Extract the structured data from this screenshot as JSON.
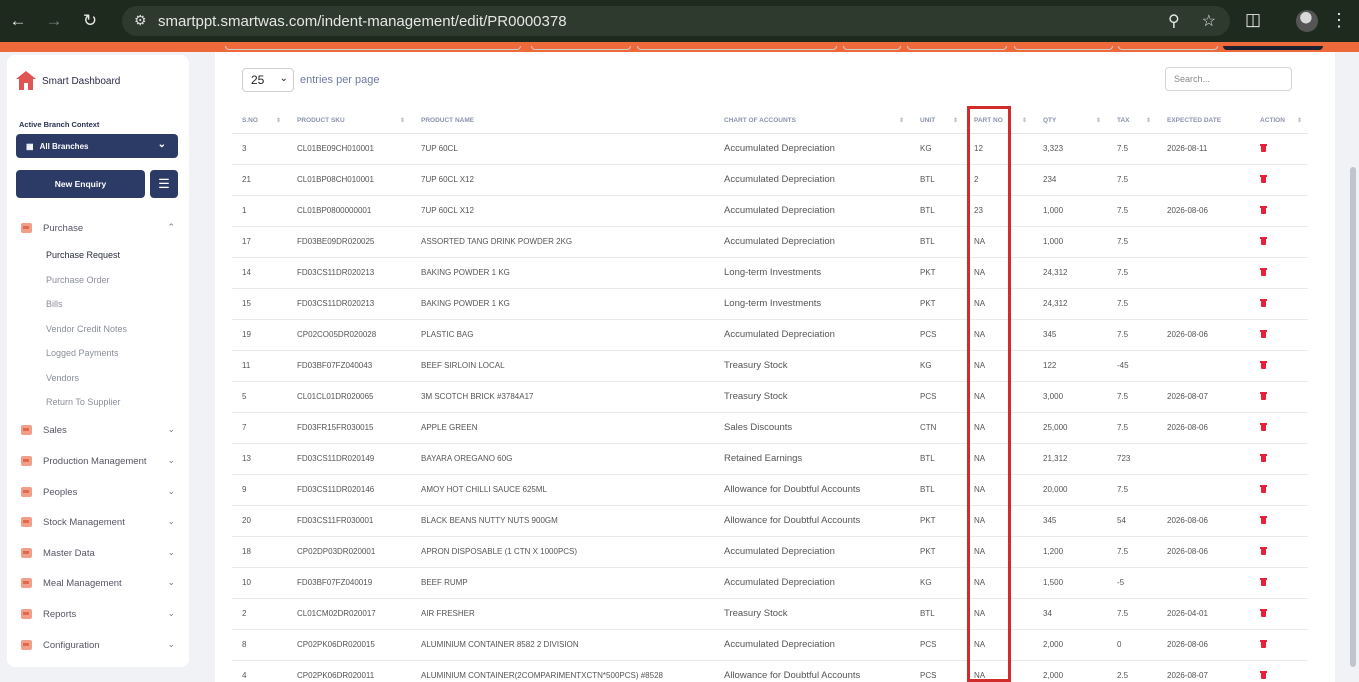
{
  "browser": {
    "url": "smartppt.smartwas.com/indent-management/edit/PR0000378"
  },
  "sidebar": {
    "brand": "Smart Dashboard",
    "branch_label": "Active Branch Context",
    "branch_value": "All Branches",
    "new_enquiry": "New Enquiry",
    "menu": [
      {
        "label": "Purchase"
      },
      {
        "label": "Sales"
      },
      {
        "label": "Production Management"
      },
      {
        "label": "Peoples"
      },
      {
        "label": "Stock Management"
      },
      {
        "label": "Master Data"
      },
      {
        "label": "Meal Management"
      },
      {
        "label": "Reports"
      },
      {
        "label": "Configuration"
      }
    ],
    "purchase_sub": [
      {
        "label": "Purchase Request"
      },
      {
        "label": "Purchase Order"
      },
      {
        "label": "Bills"
      },
      {
        "label": "Vendor Credit Notes"
      },
      {
        "label": "Logged Payments"
      },
      {
        "label": "Vendors"
      },
      {
        "label": "Return To Supplier"
      }
    ]
  },
  "table_controls": {
    "entries_value": "25",
    "entries_text": "entries per page",
    "search_placeholder": "Search..."
  },
  "table": {
    "headers": [
      "S.NO",
      "PRODUCT SKU",
      "PRODUCT NAME",
      "CHART OF ACCOUNTS",
      "UNIT",
      "PART NO",
      "QTY",
      "TAX",
      "EXPECTED DATE",
      "ACTION"
    ],
    "rows": [
      [
        "3",
        "CL01BE09CH010001",
        "7UP 60CL",
        "Accumulated Depreciation",
        "KG",
        "12",
        "3,323",
        "7.5",
        "2026-08-11"
      ],
      [
        "21",
        "CL01BP08CH010001",
        "7UP 60CL X12",
        "Accumulated Depreciation",
        "BTL",
        "2",
        "234",
        "7.5",
        ""
      ],
      [
        "1",
        "CL01BP0800000001",
        "7UP 60CL X12",
        "Accumulated Depreciation",
        "BTL",
        "23",
        "1,000",
        "7.5",
        "2026-08-06"
      ],
      [
        "17",
        "FD03BE09DR020025",
        "ASSORTED TANG DRINK POWDER 2KG",
        "Accumulated Depreciation",
        "BTL",
        "NA",
        "1,000",
        "7.5",
        ""
      ],
      [
        "14",
        "FD03CS11DR020213",
        "BAKING POWDER 1 KG",
        "Long-term Investments",
        "PKT",
        "NA",
        "24,312",
        "7.5",
        ""
      ],
      [
        "15",
        "FD03CS11DR020213",
        "BAKING POWDER 1 KG",
        "Long-term Investments",
        "PKT",
        "NA",
        "24,312",
        "7.5",
        ""
      ],
      [
        "19",
        "CP02CO05DR020028",
        "PLASTIC BAG",
        "Accumulated Depreciation",
        "PCS",
        "NA",
        "345",
        "7.5",
        "2026-08-06"
      ],
      [
        "11",
        "FD03BF07FZ040043",
        "BEEF SIRLOIN LOCAL",
        "Treasury Stock",
        "KG",
        "NA",
        "122",
        "-45",
        ""
      ],
      [
        "5",
        "CL01CL01DR020065",
        "3M SCOTCH BRICK #3784A17",
        "Treasury Stock",
        "PCS",
        "NA",
        "3,000",
        "7.5",
        "2026-08-07"
      ],
      [
        "7",
        "FD03FR15FR030015",
        "APPLE GREEN",
        "Sales Discounts",
        "CTN",
        "NA",
        "25,000",
        "7.5",
        "2026-08-06"
      ],
      [
        "13",
        "FD03CS11DR020149",
        "BAYARA OREGANO 60G",
        "Retained Earnings",
        "BTL",
        "NA",
        "21,312",
        "723",
        ""
      ],
      [
        "9",
        "FD03CS11DR020146",
        "AMOY HOT CHILLI SAUCE 625ML",
        "Allowance for Doubtful Accounts",
        "BTL",
        "NA",
        "20,000",
        "7.5",
        ""
      ],
      [
        "20",
        "FD03CS11FR030001",
        "BLACK BEANS NUTTY NUTS 900GM",
        "Allowance for Doubtful Accounts",
        "PKT",
        "NA",
        "345",
        "54",
        "2026-08-06"
      ],
      [
        "18",
        "CP02DP03DR020001",
        "APRON DISPOSABLE (1 CTN X 1000PCS)",
        "Accumulated Depreciation",
        "PKT",
        "NA",
        "1,200",
        "7.5",
        "2026-08-06"
      ],
      [
        "10",
        "FD03BF07FZ040019",
        "BEEF RUMP",
        "Accumulated Depreciation",
        "KG",
        "NA",
        "1,500",
        "-5",
        ""
      ],
      [
        "2",
        "CL01CM02DR020017",
        "AIR FRESHER",
        "Treasury Stock",
        "BTL",
        "NA",
        "34",
        "7.5",
        "2026-04-01"
      ],
      [
        "8",
        "CP02PK06DR020015",
        "ALUMINIUM CONTAINER 8582 2 DIVISION",
        "Accumulated Depreciation",
        "PCS",
        "NA",
        "2,000",
        "0",
        "2026-08-06"
      ],
      [
        "4",
        "CP02PK06DR020011",
        "ALUMINIUM CONTAINER(2COMPARIMENTXCTN*500PCS) #8528",
        "Allowance for Doubtful Accounts",
        "PCS",
        "NA",
        "2,000",
        "2.5",
        "2026-08-07"
      ]
    ]
  },
  "colors": {
    "accent": "#ef6a3a",
    "navy": "#2c3a66",
    "danger": "#e8203a",
    "highlight": "#d12b2b"
  }
}
